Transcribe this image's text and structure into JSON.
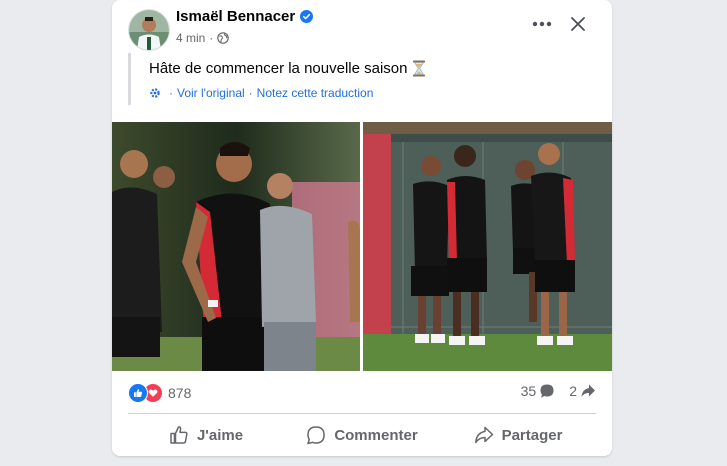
{
  "post": {
    "author": "Ismaël Bennacer",
    "time": "4 min",
    "text": "Hâte de commencer la nouvelle saison",
    "see_original": "Voir l'original",
    "rate_translation": "Notez cette traduction",
    "separator": "·"
  },
  "stats": {
    "reactions": "878",
    "comments": "35",
    "shares": "2"
  },
  "actions": {
    "like": "J'aime",
    "comment": "Commenter",
    "share": "Partager"
  },
  "colors": {
    "brand_blue": "#1877f2",
    "love_red": "#f33e58",
    "link_blue": "#216fdb",
    "muted_text": "#65676b",
    "milan_red": "#d42a36"
  },
  "icons": {
    "verified": "verified-badge-icon",
    "globe": "globe-icon",
    "more": "more-options-icon",
    "close": "close-icon",
    "hourglass": "hourglass-icon",
    "like": "thumbs-up-icon",
    "comment": "comment-bubble-icon",
    "share": "share-arrow-icon"
  }
}
